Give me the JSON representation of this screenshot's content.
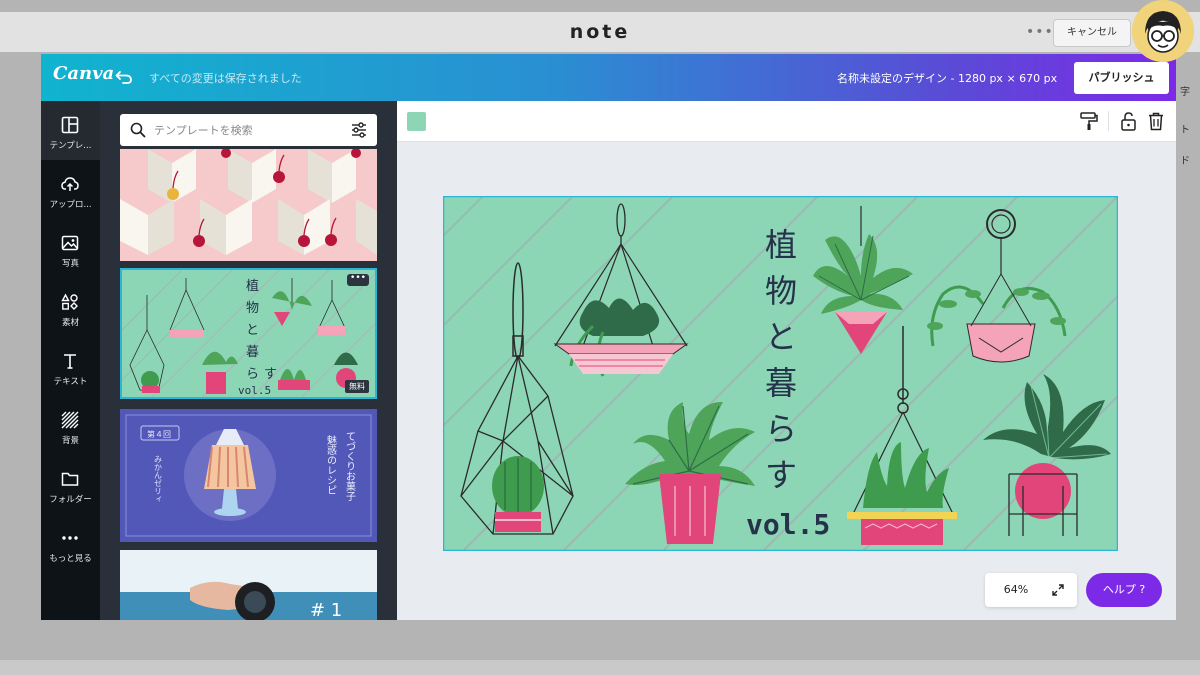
{
  "note": {
    "logo": "note",
    "more_label": "•••",
    "cancel_label": "キャンセル",
    "side_peek": [
      "字",
      "ト",
      "ド"
    ]
  },
  "canva": {
    "logo": "Canva",
    "save_status": "すべての変更は保存されました",
    "design_title": "名称未設定のデザイン - 1280 px × 670 px",
    "publish_label": "パブリッシュ"
  },
  "rail": {
    "items": [
      {
        "label": "テンプレ...",
        "icon": "template-icon"
      },
      {
        "label": "アップロ...",
        "icon": "upload-icon"
      },
      {
        "label": "写真",
        "icon": "photo-icon"
      },
      {
        "label": "素材",
        "icon": "elements-icon"
      },
      {
        "label": "テキスト",
        "icon": "text-icon"
      },
      {
        "label": "背景",
        "icon": "background-icon"
      },
      {
        "label": "フォルダー",
        "icon": "folder-icon"
      },
      {
        "label": "もっと見る",
        "icon": "more-icon"
      }
    ]
  },
  "search": {
    "placeholder": "テンプレートを検索",
    "value": ""
  },
  "templates": {
    "plants_title": "植物と暮らす",
    "plants_vol": "vol.5",
    "more_label": "•••",
    "free_badge": "無料",
    "sweets_badge": "第４回",
    "sweets_subtitle": "みかんゼリィ",
    "sweets_title_1": "てづくりお菓子",
    "sweets_title_2": "魅惑のレシピ",
    "photo_number": "# 1"
  },
  "design": {
    "title": "植物と暮らす",
    "vol": "vol.5",
    "bg_color": "#8cd6b6"
  },
  "editor": {
    "zoom": "64%",
    "help_label": "ヘルプ ?"
  },
  "colors": {
    "accent_purple": "#7d2ae8",
    "selection": "#2bb5d8",
    "pink": "#e2457a"
  }
}
